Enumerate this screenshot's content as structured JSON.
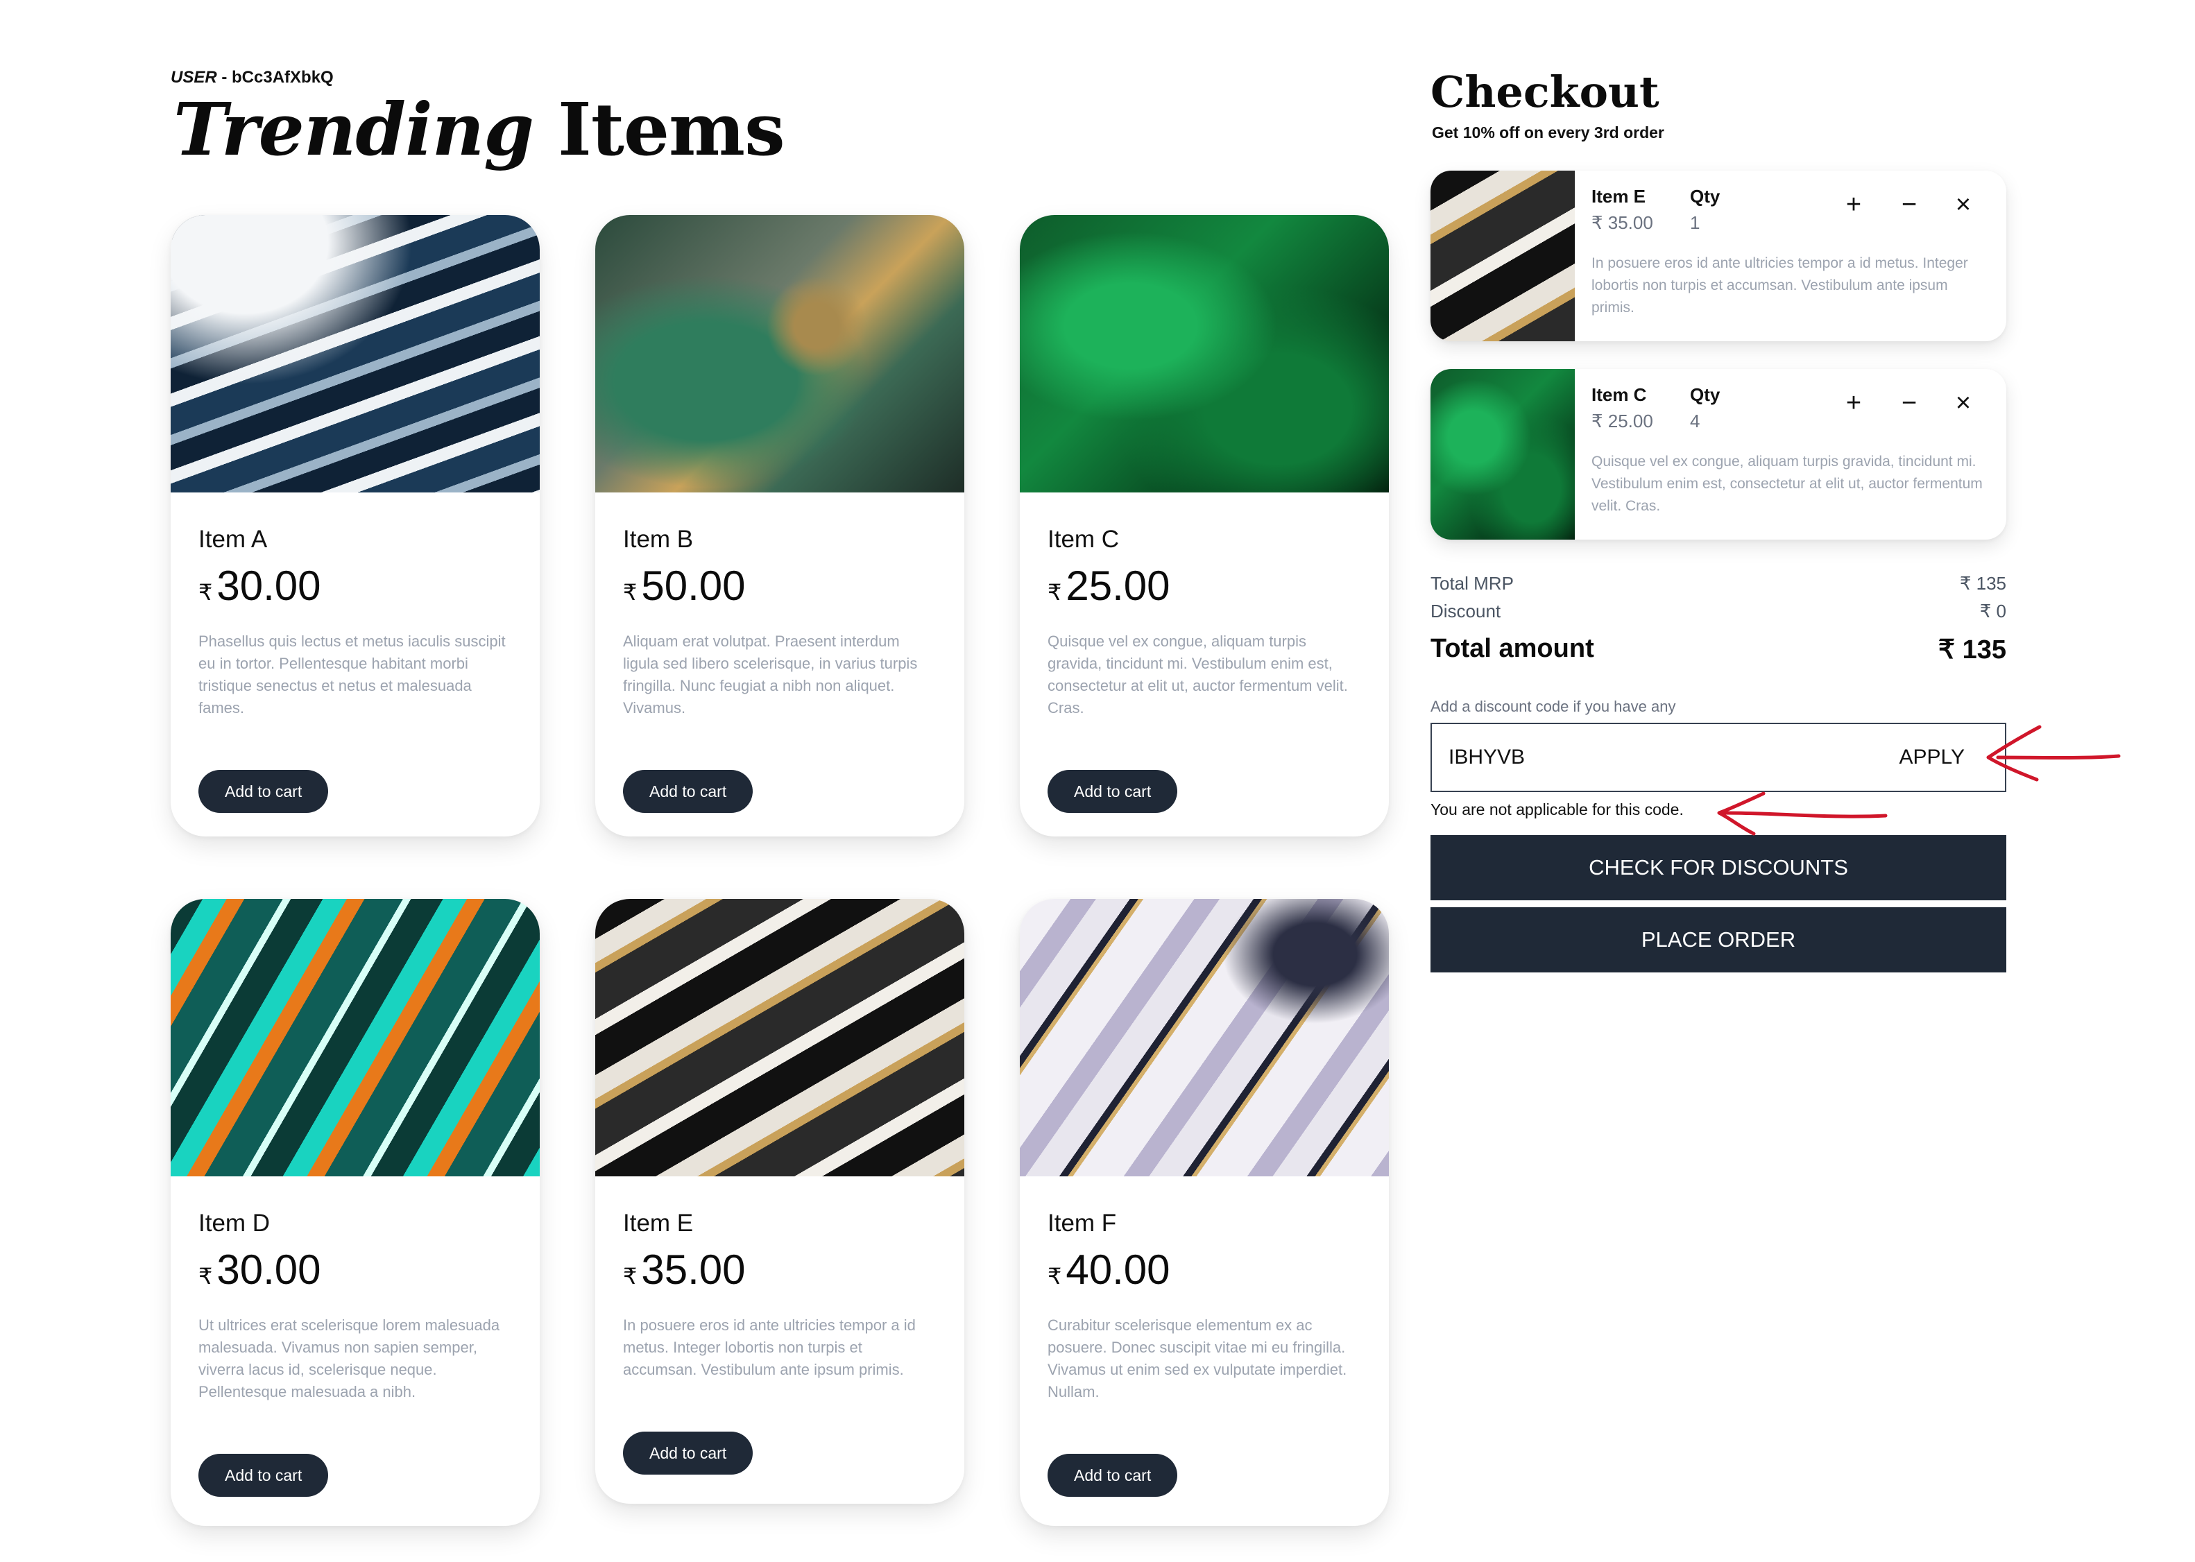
{
  "header": {
    "user_prefix": "USER",
    "user_sep": " - ",
    "user_id": "bCc3AfXbkQ",
    "title_italic": "Trending",
    "title_rest": " Items"
  },
  "currency_symbol": "₹",
  "products": [
    {
      "name": "Item A",
      "price": "30.00",
      "desc": "Phasellus quis lectus et metus iaculis suscipit eu in tortor. Pellentesque habitant morbi tristique senectus et netus et malesuada fames.",
      "button": "Add to cart"
    },
    {
      "name": "Item B",
      "price": "50.00",
      "desc": "Aliquam erat volutpat. Praesent interdum ligula sed libero scelerisque, in varius turpis fringilla. Nunc feugiat a nibh non aliquet. Vivamus.",
      "button": "Add to cart"
    },
    {
      "name": "Item C",
      "price": "25.00",
      "desc": "Quisque vel ex congue, aliquam turpis gravida, tincidunt mi. Vestibulum enim est, consectetur at elit ut, auctor fermentum velit. Cras.",
      "button": "Add to cart"
    },
    {
      "name": "Item D",
      "price": "30.00",
      "desc": "Ut ultrices erat scelerisque lorem malesuada malesuada. Vivamus non sapien semper, viverra lacus id, scelerisque neque. Pellentesque malesuada a nibh.",
      "button": "Add to cart"
    },
    {
      "name": "Item E",
      "price": "35.00",
      "desc": "In posuere eros id ante ultricies tempor a id metus. Integer lobortis non turpis et accumsan. Vestibulum ante ipsum primis.",
      "button": "Add to cart"
    },
    {
      "name": "Item F",
      "price": "40.00",
      "desc": "Curabitur scelerisque elementum ex ac posuere. Donec suscipit vitae mi eu fringilla. Vivamus ut enim sed ex vulputate imperdiet. Nullam.",
      "button": "Add to cart"
    }
  ],
  "checkout": {
    "title": "Checkout",
    "subtitle": "Get 10% off on every 3rd order",
    "qty_label": "Qty",
    "items": [
      {
        "name": "Item E",
        "price": "₹ 35.00",
        "qty": "1",
        "desc": "In posuere eros id ante ultricies tempor a id metus. Integer lobortis non turpis et accumsan. Vestibulum ante ipsum primis.",
        "plus": "+",
        "minus": "−",
        "remove": "×"
      },
      {
        "name": "Item C",
        "price": "₹ 25.00",
        "qty": "4",
        "desc": "Quisque vel ex congue, aliquam turpis gravida, tincidunt mi. Vestibulum enim est, consectetur at elit ut, auctor fermentum velit. Cras.",
        "plus": "+",
        "minus": "−",
        "remove": "×"
      }
    ],
    "summary": {
      "mrp_label": "Total MRP",
      "mrp_value": "₹ 135",
      "discount_label": "Discount",
      "discount_value": "₹ 0",
      "total_label": "Total amount",
      "total_value": "₹ 135"
    },
    "discount": {
      "label": "Add a discount code if you have any",
      "value": "IBHYVB",
      "apply": "APPLY",
      "message": "You are not applicable for this code."
    },
    "check_button": "CHECK FOR DISCOUNTS",
    "place_button": "PLACE ORDER"
  },
  "colors": {
    "button_dark": "#1f2937",
    "annotation_red": "#d0162a"
  }
}
